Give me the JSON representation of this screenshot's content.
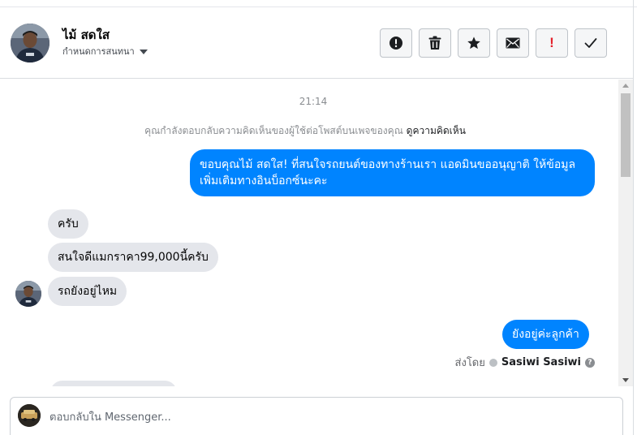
{
  "header": {
    "contact_name": "ไม้ สดใส",
    "assign_label": "กำหนดการสนทนา",
    "actions": [
      {
        "name": "mark-spam-button",
        "icon": "alert-circle-icon"
      },
      {
        "name": "delete-button",
        "icon": "trash-icon"
      },
      {
        "name": "star-button",
        "icon": "star-icon"
      },
      {
        "name": "mark-unread-button",
        "icon": "envelope-icon"
      },
      {
        "name": "follow-up-button",
        "icon": "exclamation-icon",
        "glyph": "!"
      },
      {
        "name": "mark-done-button",
        "icon": "check-icon"
      }
    ]
  },
  "conversation": {
    "timestamp": "21:14",
    "notice_text": "คุณกำลังตอบกลับความคิดเห็นของผู้ใช้ต่อโพสต์บนเพจของคุณ",
    "notice_link": "ดูความคิดเห็น",
    "messages": [
      {
        "direction": "out",
        "text": "ขอบคุณไม้ สดใส! ที่สนใจรถยนต์ของทางร้านเรา แอดมินขออนุญาติ ให้ข้อมูลเพิ่มเติมทางอินบ็อกซ์นะคะ"
      },
      {
        "direction": "in",
        "text": "ครับ"
      },
      {
        "direction": "in",
        "text": "สนใจดีแมกราคา99,000นี้ครับ"
      },
      {
        "direction": "in",
        "text": "รถยังอยู่ไหม"
      },
      {
        "direction": "out",
        "text": "ยังอยู่ค่ะลูกค้า"
      }
    ],
    "sent_by_label": "ส่งโดย",
    "sent_by_name": "Sasiwi Sasiwi",
    "help_glyph": "?"
  },
  "composer": {
    "placeholder": "ตอบกลับใน Messenger..."
  },
  "colors": {
    "outgoing_bubble": "#0084ff",
    "incoming_bubble": "#e4e6eb",
    "follow_up_icon": "#e4212b"
  }
}
